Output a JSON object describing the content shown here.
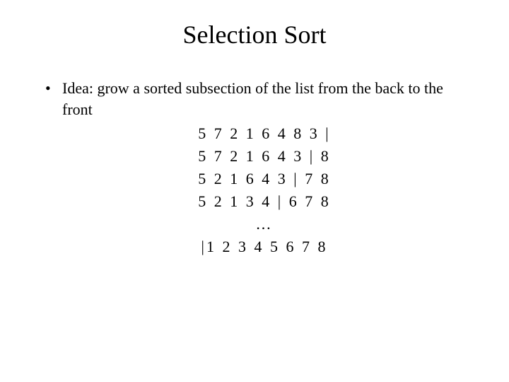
{
  "title": "Selection Sort",
  "bullet": "Idea: grow a sorted subsection of the list from the back to the front",
  "steps": [
    "5 7 2 1 6 4 8 3 |",
    "5 7 2 1 6 4 3 | 8",
    "5 2 1 6 4 3 | 7 8",
    "5 2 1 3 4 | 6 7 8",
    "…",
    "|1 2 3 4 5 6 7 8"
  ]
}
